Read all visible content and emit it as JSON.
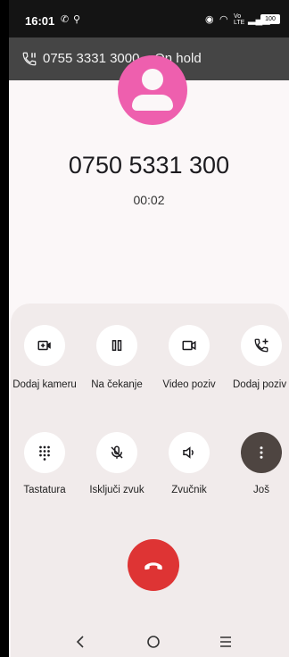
{
  "status_bar": {
    "time": "16:01",
    "battery": "100"
  },
  "hold_banner": {
    "text": "0755 3331 3000 – On hold"
  },
  "call": {
    "number": "0750 5331 300",
    "timer": "00:02"
  },
  "actions": [
    {
      "label": "Dodaj kameru",
      "icon": "add-video-icon"
    },
    {
      "label": "Na čekanje",
      "icon": "pause-icon"
    },
    {
      "label": "Video poziv",
      "icon": "videocam-icon"
    },
    {
      "label": "Dodaj poziv",
      "icon": "add-call-icon"
    },
    {
      "label": "Tastatura",
      "icon": "dialpad-icon"
    },
    {
      "label": "Isključi zvuk",
      "icon": "mic-off-icon"
    },
    {
      "label": "Zvučnik",
      "icon": "speaker-icon"
    },
    {
      "label": "Još",
      "icon": "more-vert-icon"
    }
  ],
  "colors": {
    "avatar": "#ee5fae",
    "end_call": "#de3434",
    "panel": "#f1ebeb",
    "hold_bar": "#454545"
  }
}
